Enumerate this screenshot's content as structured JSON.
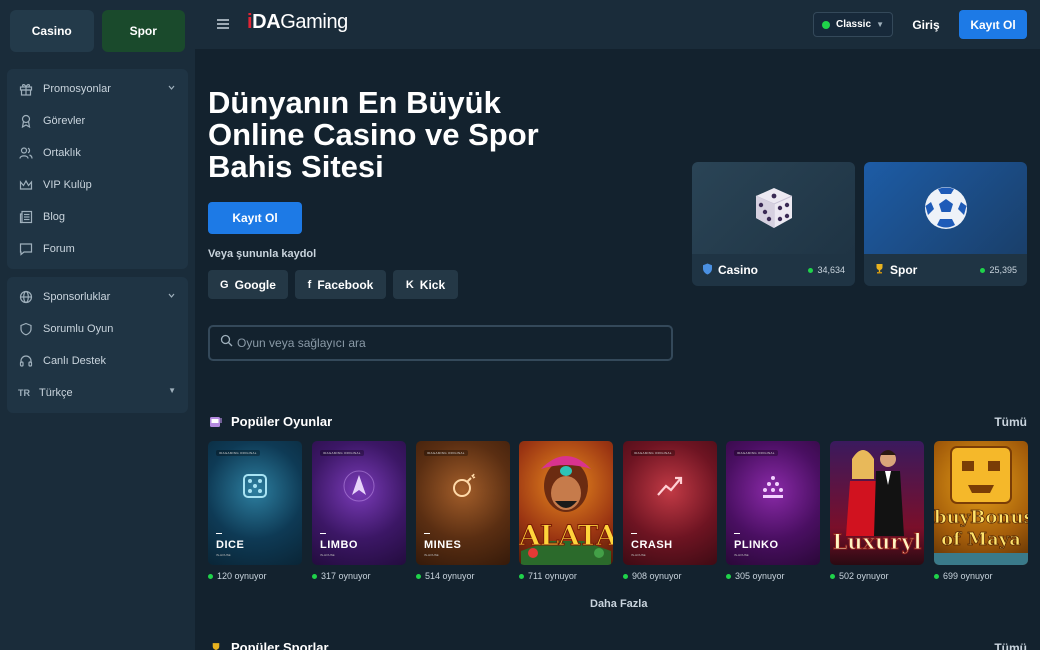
{
  "sidebar": {
    "tabs": [
      {
        "label": "Casino"
      },
      {
        "label": "Spor"
      }
    ],
    "group1": [
      {
        "label": "Promosyonlar",
        "icon": "gift-icon"
      },
      {
        "label": "Görevler",
        "icon": "award-icon"
      },
      {
        "label": "Ortaklık",
        "icon": "users-icon"
      },
      {
        "label": "VIP Kulüp",
        "icon": "crown-icon"
      },
      {
        "label": "Blog",
        "icon": "newspaper-icon"
      },
      {
        "label": "Forum",
        "icon": "chat-icon"
      }
    ],
    "group2": [
      {
        "label": "Sponsorluklar",
        "icon": "globe-icon"
      },
      {
        "label": "Sorumlu Oyun",
        "icon": "shield-icon"
      },
      {
        "label": "Canlı Destek",
        "icon": "headset-icon"
      }
    ],
    "language": {
      "code": "TR",
      "label": "Türkçe"
    }
  },
  "header": {
    "logo": {
      "part1": "iDA",
      "part2": "Gaming"
    },
    "theme": "Classic",
    "login": "Giriş",
    "register": "Kayıt Ol"
  },
  "hero": {
    "title": "Dünyanın En Büyük Online Casino ve Spor Bahis Sitesi",
    "register": "Kayıt Ol",
    "or_text": "Veya şununla kaydol",
    "social": [
      {
        "icon": "G",
        "label": "Google"
      },
      {
        "icon": "f",
        "label": "Facebook"
      },
      {
        "icon": "K",
        "label": "Kick"
      }
    ]
  },
  "search": {
    "placeholder": "Oyun veya sağlayıcı ara"
  },
  "categories": [
    {
      "label": "Casino",
      "count": "34,634"
    },
    {
      "label": "Spor",
      "count": "25,395"
    }
  ],
  "popular_games": {
    "title": "Popüler Oyunlar",
    "see_all": "Tümü",
    "more": "Daha Fazla",
    "original_tag": "IDAGAMING ORIGINAL",
    "inhouse": "IN-HOUSE",
    "games": [
      {
        "name": "DICE",
        "players": "120 oynuyor"
      },
      {
        "name": "LIMBO",
        "players": "317 oynuyor"
      },
      {
        "name": "MINES",
        "players": "514 oynuyor"
      },
      {
        "name": "ALATA",
        "players": "711 oynuyor"
      },
      {
        "name": "CRASH",
        "players": "908 oynuyor"
      },
      {
        "name": "PLINKO",
        "players": "305 oynuyor"
      },
      {
        "name": "Luxuryl",
        "players": "502 oynuyor"
      },
      {
        "name": "buyBonus of Maya",
        "players": "699 oynuyor"
      }
    ]
  },
  "popular_sports": {
    "title": "Popüler Sporlar",
    "see_all": "Tümü"
  },
  "colors": {
    "accent": "#1d7ae6",
    "online": "#1fd34a",
    "brand_red": "#e02434"
  }
}
